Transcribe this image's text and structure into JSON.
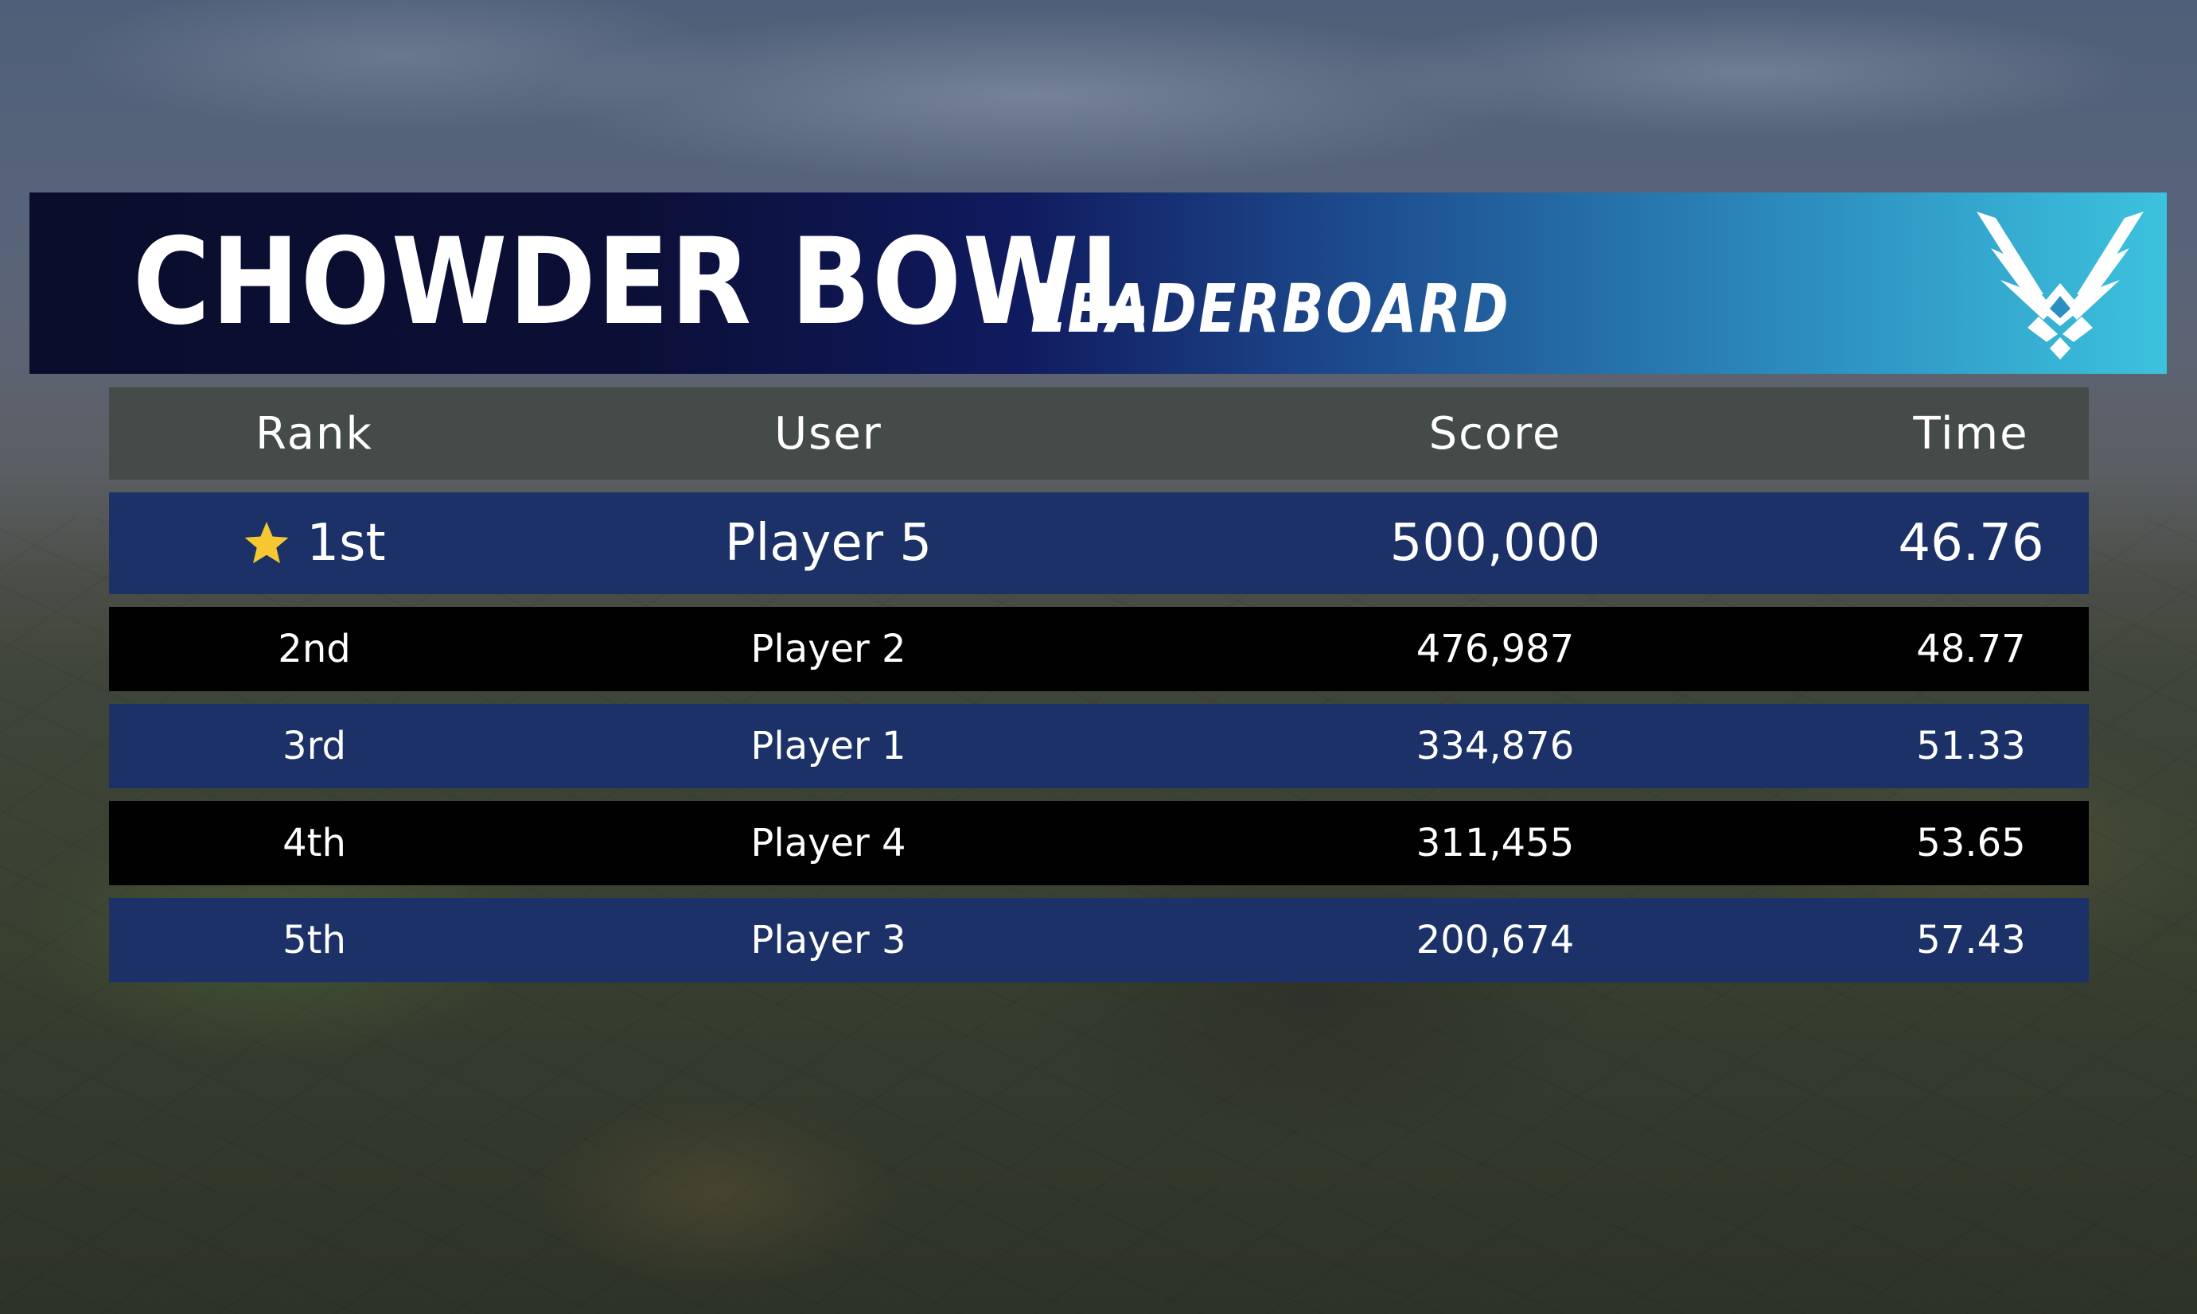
{
  "title": {
    "main": "CHOWDER BOWL",
    "sub": "LEADERBOARD"
  },
  "logo_icon": "air-force-wings-icon",
  "colors": {
    "banner_start": "#0a0e2c",
    "banner_end": "#3cc2de",
    "header_row": "#454b48",
    "row_blue": "#1b3168",
    "row_black": "#010101",
    "star": "#f5c832"
  },
  "table": {
    "headers": [
      "Rank",
      "User",
      "Score",
      "Time"
    ],
    "rows": [
      {
        "rank": "1st",
        "user": "Player 5",
        "score": "500,000",
        "time": "46.76",
        "icon": "star-icon"
      },
      {
        "rank": "2nd",
        "user": "Player 2",
        "score": "476,987",
        "time": "48.77"
      },
      {
        "rank": "3rd",
        "user": "Player 1",
        "score": "334,876",
        "time": "51.33"
      },
      {
        "rank": "4th",
        "user": "Player 4",
        "score": "311,455",
        "time": "53.65"
      },
      {
        "rank": "5th",
        "user": "Player 3",
        "score": "200,674",
        "time": "57.43"
      }
    ]
  }
}
